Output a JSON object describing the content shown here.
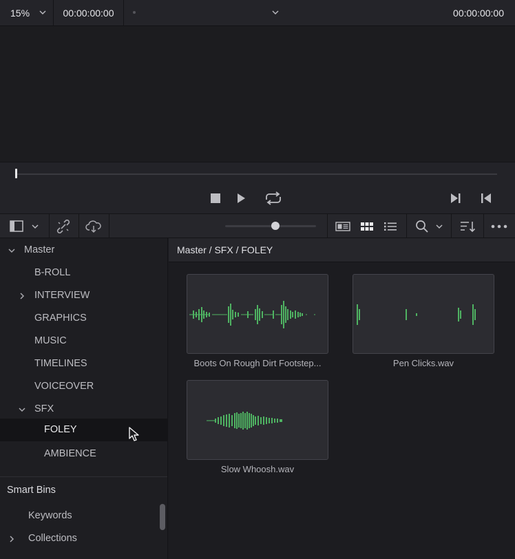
{
  "viewer": {
    "zoom": "15%",
    "timecode_left": "00:00:00:00",
    "timecode_right": "00:00:00:00"
  },
  "colors": {
    "waveform": "#4fb362",
    "selected_bg": "#141417",
    "panel_bg": "#1e1e22"
  },
  "sidebar": {
    "root": {
      "label": "Master",
      "expanded": true
    },
    "items": [
      {
        "label": "B-ROLL"
      },
      {
        "label": "INTERVIEW",
        "collapsed": true
      },
      {
        "label": "GRAPHICS"
      },
      {
        "label": "MUSIC"
      },
      {
        "label": "TIMELINES"
      },
      {
        "label": "VOICEOVER"
      },
      {
        "label": "SFX",
        "expanded": true
      },
      {
        "label": "FOLEY",
        "selected": true
      },
      {
        "label": "AMBIENCE"
      }
    ],
    "smart_bins": {
      "title": "Smart Bins",
      "items": [
        {
          "label": "Keywords"
        },
        {
          "label": "Collections"
        }
      ]
    }
  },
  "content": {
    "breadcrumb": "Master / SFX / FOLEY",
    "clips": [
      {
        "name": "Boots On Rough Dirt Footstep..."
      },
      {
        "name": "Pen Clicks.wav"
      },
      {
        "name": "Slow Whoosh.wav"
      }
    ]
  },
  "icons": {
    "zoom_menu": "chevron-down-icon",
    "stop": "stop-icon",
    "play": "play-icon",
    "loop": "loop-icon",
    "next": "next-clip-icon",
    "prev": "previous-clip-icon",
    "panel": "panel-layout-icon",
    "unlink": "unlink-icon",
    "cloud": "cloud-sync-icon",
    "metadata_view": "metadata-view-icon",
    "thumbnail_view": "thumbnail-grid-icon",
    "list_view": "list-view-icon",
    "search": "search-icon",
    "sort": "sort-icon",
    "more": "more-options-icon",
    "cursor": "mouse-cursor-icon"
  }
}
